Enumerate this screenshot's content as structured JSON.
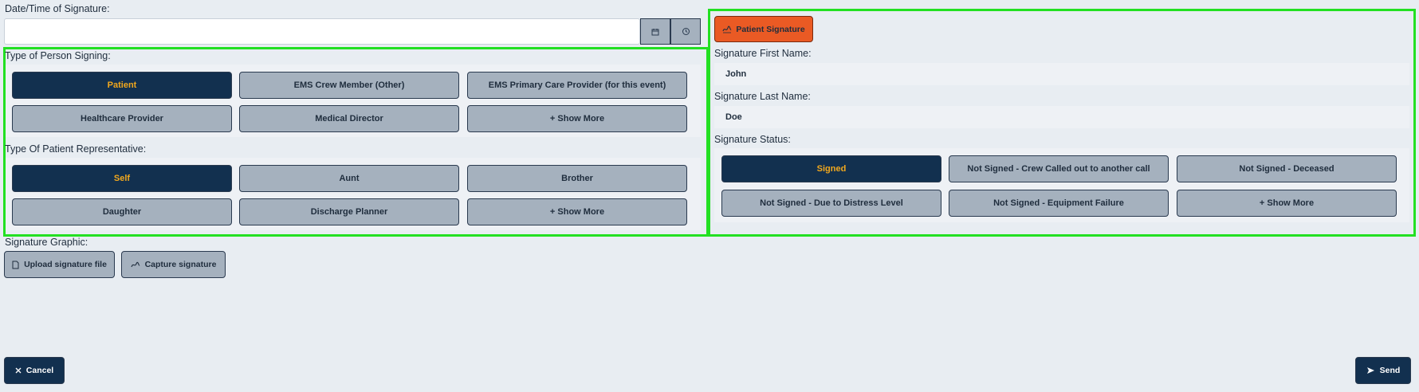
{
  "date_time": {
    "label": "Date/Time of Signature:",
    "value": "",
    "calendar_icon": "calendar-icon",
    "history_icon": "history-icon"
  },
  "person_signing": {
    "label": "Type of Person Signing:",
    "options": [
      "Patient",
      "EMS Crew Member (Other)",
      "EMS Primary Care Provider (for this event)",
      "Healthcare Provider",
      "Medical Director",
      "+ Show More"
    ],
    "selected": "Patient"
  },
  "patient_representative": {
    "label": "Type Of Patient Representative:",
    "options": [
      "Self",
      "Aunt",
      "Brother",
      "Daughter",
      "Discharge Planner",
      "+ Show More"
    ],
    "selected": "Self"
  },
  "signature_graphic": {
    "label": "Signature Graphic:",
    "upload_label": "Upload signature file",
    "capture_label": "Capture signature"
  },
  "patient_signature_button": "Patient Signature",
  "first_name": {
    "label": "Signature First Name:",
    "value": "John"
  },
  "last_name": {
    "label": "Signature Last Name:",
    "value": "Doe"
  },
  "signature_status": {
    "label": "Signature Status:",
    "options": [
      "Signed",
      "Not Signed - Crew Called out to another call",
      "Not Signed - Deceased",
      "Not Signed - Due to Distress Level",
      "Not Signed - Equipment Failure",
      "+ Show More"
    ],
    "selected": "Signed"
  },
  "footer": {
    "cancel_label": "Cancel",
    "send_label": "Send"
  },
  "colors": {
    "selected_bg": "#12304f",
    "selected_text": "#f2a81d",
    "option_bg": "#a5b1be",
    "accent_orange": "#ea5a24",
    "highlight_green": "#22e022"
  }
}
